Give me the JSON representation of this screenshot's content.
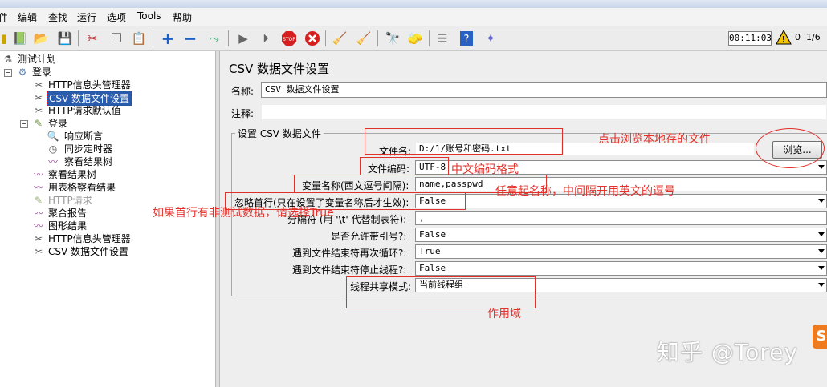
{
  "menu": [
    "件",
    "编辑",
    "查找",
    "运行",
    "选项",
    "Tools",
    "帮助"
  ],
  "toolbar": {
    "timer": "00:11:03",
    "warning_count": "0",
    "thread_ratio": "1/6",
    "icons": [
      "templates-icon",
      "open-icon",
      "save-icon",
      "cut-icon",
      "copy-icon",
      "paste-icon",
      "expand-icon",
      "collapse-icon",
      "toggle-icon",
      "start-icon",
      "start-no-pause-icon",
      "stop-icon",
      "shutdown-icon",
      "clear-icon",
      "clear-all-icon",
      "search-icon",
      "reset-search-icon",
      "function-helper-icon",
      "help-icon",
      "remote-icon"
    ]
  },
  "tree": {
    "root": "测试计划",
    "group": "登录",
    "items": [
      {
        "label": "HTTP信息头管理器",
        "icon": "config-icon"
      },
      {
        "label": "CSV 数据文件设置",
        "icon": "config-icon"
      },
      {
        "label": "HTTP请求默认值",
        "icon": "config-icon"
      },
      {
        "label": "登录",
        "icon": "sampler-icon"
      },
      {
        "label": "响应断言",
        "icon": "assertion-icon"
      },
      {
        "label": "同步定时器",
        "icon": "timer-icon"
      },
      {
        "label": "察看结果树",
        "icon": "listener-icon"
      },
      {
        "label": "察看结果树",
        "icon": "listener-icon"
      },
      {
        "label": "用表格察看结果",
        "icon": "listener-icon"
      },
      {
        "label": "HTTP请求",
        "icon": "sampler-icon"
      },
      {
        "label": "聚合报告",
        "icon": "listener-icon"
      },
      {
        "label": "图形结果",
        "icon": "listener-icon"
      },
      {
        "label": "HTTP信息头管理器",
        "icon": "config-icon"
      },
      {
        "label": "CSV 数据文件设置",
        "icon": "config-icon"
      }
    ]
  },
  "panel": {
    "title": "CSV 数据文件设置",
    "name_label": "名称:",
    "name_value": "CSV 数据文件设置",
    "comment_label": "注释:",
    "comment_value": "",
    "group_title": "设置 CSV 数据文件",
    "browse_label": "浏览...",
    "fields": {
      "filename": {
        "label": "文件名:",
        "value": "D:/1/账号和密码.txt"
      },
      "encoding": {
        "label": "文件编码:",
        "value": "UTF-8"
      },
      "varnames": {
        "label": "变量名称(西文逗号间隔):",
        "value": "name,passpwd"
      },
      "ignore_first": {
        "label": "忽略首行(只在设置了变量名称后才生效):",
        "value": "False"
      },
      "delimiter": {
        "label": "分隔符 (用 '\\t' 代替制表符):",
        "value": ","
      },
      "quoted": {
        "label": "是否允许带引号?:",
        "value": "False"
      },
      "recycle": {
        "label": "遇到文件结束符再次循环?:",
        "value": "True"
      },
      "stop_thread": {
        "label": "遇到文件结束符停止线程?:",
        "value": "False"
      },
      "sharing": {
        "label": "线程共享模式:",
        "value": "当前线程组"
      }
    }
  },
  "annotations": {
    "browse": "点击浏览本地存的文件",
    "encoding": "中文编码格式",
    "varnames": "任意起名称，中间隔开用英文的逗号",
    "ignore_first": "如果首行有非测试数据，请选择True",
    "sharing": "作用域"
  },
  "watermark": "知乎 @Torey",
  "watermark_logo": "S",
  "colors": {
    "annotation": "#e4302a",
    "selection": "#2a5cae"
  }
}
